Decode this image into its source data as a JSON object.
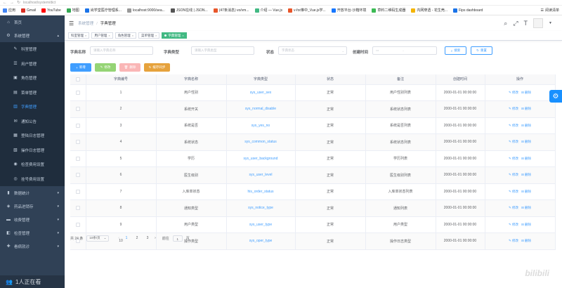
{
  "browser": {
    "address": "localhost/system/dict"
  },
  "bookmarks": [
    {
      "label": "应用",
      "color": "#4285f4"
    },
    {
      "label": "Gmail",
      "color": "#d93025"
    },
    {
      "label": "YouTube",
      "color": "#ff0000"
    },
    {
      "label": "地图",
      "color": "#34a853"
    },
    {
      "label": "尚学堂医疗管理系...",
      "color": "#1a73e8"
    },
    {
      "label": "localhost:9000/sea...",
      "color": "#999999"
    },
    {
      "label": "JSON在线 | JSON...",
      "color": "#555555"
    },
    {
      "label": "(47条消息) vo/vm...",
      "color": "#e8562a"
    },
    {
      "label": "介绍 — Vue.js",
      "color": "#42b983"
    },
    {
      "label": "v-for推中_Vue.js学...",
      "color": "#e8562a"
    },
    {
      "label": "开放平台-沙箱环境",
      "color": "#1677ff"
    },
    {
      "label": "草料二维码生成器",
      "color": "#3cba54"
    },
    {
      "label": "内网穿透 - 花生壳...",
      "color": "#f4b400"
    },
    {
      "label": "Fips dashboard",
      "color": "#1a73e8"
    }
  ],
  "bookmarks_right": "阅读清单",
  "sidebar": {
    "items": [
      {
        "label": "首页",
        "icon": "dashboard-icon",
        "sub": false,
        "active": false,
        "arrow": ""
      },
      {
        "label": "系统管理",
        "icon": "system-icon",
        "sub": false,
        "active": false,
        "arrow": "▴"
      },
      {
        "label": "科室管理",
        "icon": "dept-icon",
        "sub": true,
        "active": false,
        "arrow": ""
      },
      {
        "label": "用户管理",
        "icon": "user-icon",
        "sub": true,
        "active": false,
        "arrow": ""
      },
      {
        "label": "角色管理",
        "icon": "role-icon",
        "sub": true,
        "active": false,
        "arrow": ""
      },
      {
        "label": "菜单管理",
        "icon": "menu-icon",
        "sub": true,
        "active": false,
        "arrow": ""
      },
      {
        "label": "字典管理",
        "icon": "dict-icon",
        "sub": true,
        "active": true,
        "arrow": ""
      },
      {
        "label": "通知公告",
        "icon": "notice-icon",
        "sub": true,
        "active": false,
        "arrow": ""
      },
      {
        "label": "登陆日志管理",
        "icon": "login-log-icon",
        "sub": true,
        "active": false,
        "arrow": ""
      },
      {
        "label": "操作日志管理",
        "icon": "oper-log-icon",
        "sub": true,
        "active": false,
        "arrow": ""
      },
      {
        "label": "检查费用设置",
        "icon": "check-fee-icon",
        "sub": true,
        "active": false,
        "arrow": ""
      },
      {
        "label": "挂号费用设置",
        "icon": "register-fee-icon",
        "sub": true,
        "active": false,
        "arrow": ""
      },
      {
        "label": "数据统计",
        "icon": "stats-icon",
        "sub": false,
        "active": false,
        "arrow": "▾"
      },
      {
        "label": "药品进销存",
        "icon": "drug-icon",
        "sub": false,
        "active": false,
        "arrow": "▾"
      },
      {
        "label": "收费管理",
        "icon": "charge-icon",
        "sub": false,
        "active": false,
        "arrow": "▾"
      },
      {
        "label": "检查管理",
        "icon": "inspect-icon",
        "sub": false,
        "active": false,
        "arrow": "▾"
      },
      {
        "label": "看病就诊",
        "icon": "visit-icon",
        "sub": false,
        "active": false,
        "arrow": "▾"
      }
    ],
    "watching": "1人正在看"
  },
  "header": {
    "breadcrumb": [
      "系统管理",
      "字典管理"
    ]
  },
  "tags": [
    {
      "label": "科室管理",
      "active": false
    },
    {
      "label": "用户管理",
      "active": false
    },
    {
      "label": "角色管理",
      "active": false
    },
    {
      "label": "菜单管理",
      "active": false
    },
    {
      "label": "字典管理",
      "active": true
    }
  ],
  "search": {
    "dict_name_label": "字典名称",
    "dict_name_placeholder": "请输入字典名称",
    "dict_type_label": "字典类型",
    "dict_type_placeholder": "请输入字典类型",
    "status_label": "状态",
    "status_placeholder": "字典状态",
    "created_label": "创建时间",
    "date_sep": "-",
    "search_btn": "搜索",
    "reset_btn": "重置"
  },
  "toolbar": {
    "add": "新增",
    "edit": "修改",
    "delete": "删除",
    "refresh": "缓存同步"
  },
  "table": {
    "headers": [
      "字典编号",
      "字典名称",
      "字典类型",
      "状态",
      "备注",
      "创建时间",
      "操作"
    ],
    "edit_label": "修改",
    "delete_label": "删除",
    "rows": [
      {
        "id": "1",
        "name": "用户性别",
        "type": "sys_user_sex",
        "status": "正常",
        "remark": "用户性别列表",
        "time": "2000-01-01 00:00:00"
      },
      {
        "id": "2",
        "name": "系统开关",
        "type": "sys_normal_disable",
        "status": "正常",
        "remark": "系统状态列表",
        "time": "2000-01-01 00:00:00"
      },
      {
        "id": "3",
        "name": "系统是否",
        "type": "sys_yes_no",
        "status": "正常",
        "remark": "系统是否列表",
        "time": "2000-01-01 00:00:00"
      },
      {
        "id": "4",
        "name": "系统状态",
        "type": "sys_common_status",
        "status": "正常",
        "remark": "系统状态列表",
        "time": "2000-01-01 00:00:00"
      },
      {
        "id": "5",
        "name": "学历",
        "type": "sys_user_background",
        "status": "正常",
        "remark": "学历列表",
        "time": "2000-01-01 00:00:00"
      },
      {
        "id": "6",
        "name": "医生级别",
        "type": "sys_user_level",
        "status": "正常",
        "remark": "医生级别列表",
        "time": "2000-01-01 00:00:00"
      },
      {
        "id": "7",
        "name": "入库单状态",
        "type": "his_order_status",
        "status": "正常",
        "remark": "入库单状态列表",
        "time": "2000-01-01 00:00:00"
      },
      {
        "id": "8",
        "name": "通知类型",
        "type": "sys_notice_type",
        "status": "正常",
        "remark": "通知列表",
        "time": "2000-01-01 00:00:00"
      },
      {
        "id": "9",
        "name": "用户类型",
        "type": "sys_user_type",
        "status": "正常",
        "remark": "用户类型",
        "time": "2000-01-01 00:00:00"
      },
      {
        "id": "10",
        "name": "操作类型",
        "type": "sys_oper_type",
        "status": "正常",
        "remark": "操作日志类型",
        "time": "2000-01-01 00:00:00"
      }
    ]
  },
  "pagination": {
    "total": "共 24 条",
    "page_size": "10条/页",
    "pages": [
      "1",
      "2",
      "3"
    ],
    "current": "1",
    "goto_label": "前往",
    "goto_value": "1",
    "page_suffix": "页"
  },
  "colors": {
    "primary": "#409eff",
    "success": "#67c23a",
    "danger": "#f56c6c",
    "warning": "#e6a23c",
    "sidebar": "#304156",
    "tag_active": "#42b983"
  }
}
